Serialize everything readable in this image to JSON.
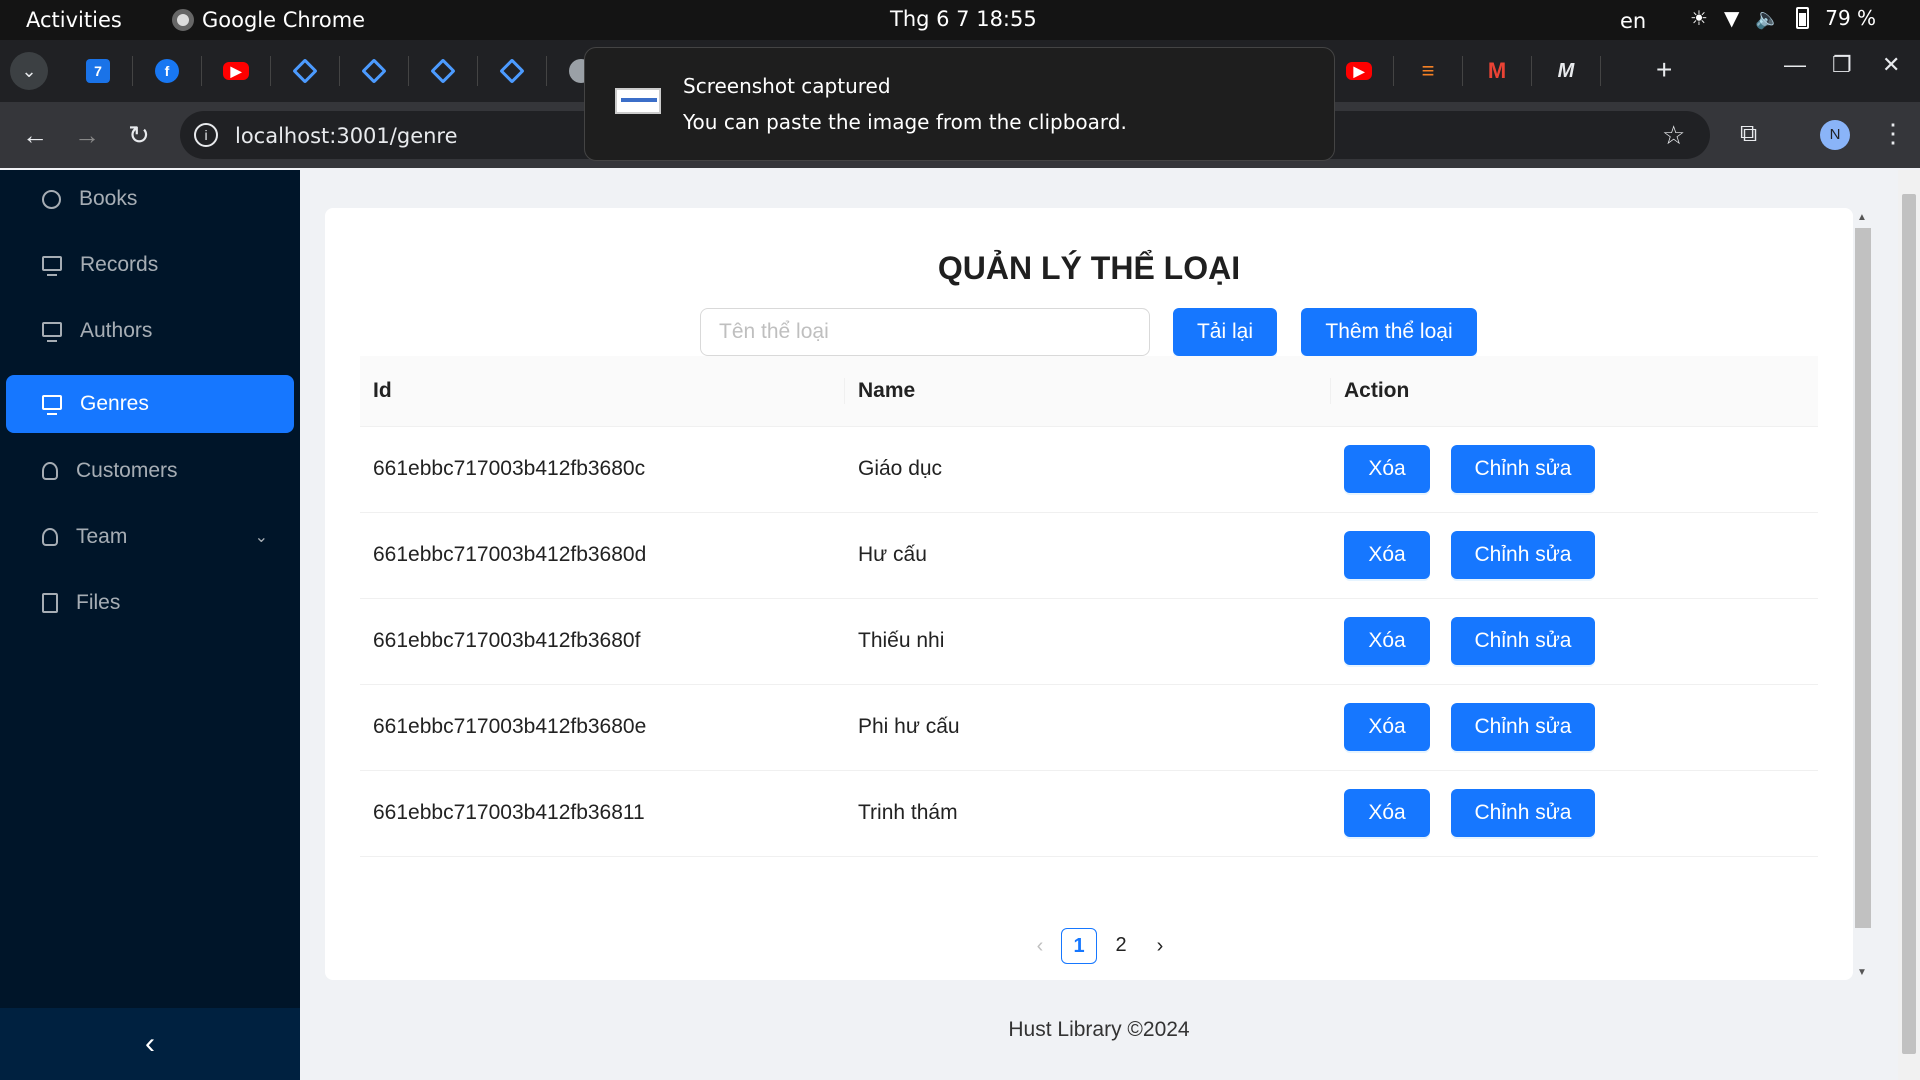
{
  "system": {
    "activities": "Activities",
    "app_name": "Google Chrome",
    "clock": "Thg 6 7  18:55",
    "lang": "en",
    "battery": "79 %"
  },
  "browser": {
    "url": "localhost:3001/genre",
    "avatar_letter": "N"
  },
  "notification": {
    "title": "Screenshot captured",
    "body": "You can paste the image from the clipboard."
  },
  "sidebar": {
    "items": [
      {
        "label": "Books",
        "icon": "pie-chart-icon"
      },
      {
        "label": "Records",
        "icon": "desktop-icon"
      },
      {
        "label": "Authors",
        "icon": "desktop-icon"
      },
      {
        "label": "Genres",
        "icon": "desktop-icon",
        "active": true
      },
      {
        "label": "Customers",
        "icon": "user-icon"
      },
      {
        "label": "Team",
        "icon": "team-icon"
      },
      {
        "label": "Files",
        "icon": "file-icon"
      }
    ],
    "collapse_glyph": "‹"
  },
  "main": {
    "title": "QUẢN LÝ THỂ LOẠI",
    "search_placeholder": "Tên thể loại",
    "reload_label": "Tải lại",
    "add_label": "Thêm thể loại",
    "columns": [
      "Id",
      "Name",
      "Action"
    ],
    "rows": [
      {
        "id": "661ebbc717003b412fb3680c",
        "name": "Giáo dục"
      },
      {
        "id": "661ebbc717003b412fb3680d",
        "name": "Hư cấu"
      },
      {
        "id": "661ebbc717003b412fb3680f",
        "name": "Thiếu nhi"
      },
      {
        "id": "661ebbc717003b412fb3680e",
        "name": "Phi hư cấu"
      },
      {
        "id": "661ebbc717003b412fb36811",
        "name": "Trinh thám"
      }
    ],
    "delete_label": "Xóa",
    "edit_label": "Chỉnh sửa",
    "pagination": {
      "current": "1",
      "pages": [
        "1",
        "2"
      ]
    }
  },
  "footer": "Hust Library ©2024",
  "colors": {
    "primary": "#1677ff",
    "sidebar_bg": "#001529"
  }
}
